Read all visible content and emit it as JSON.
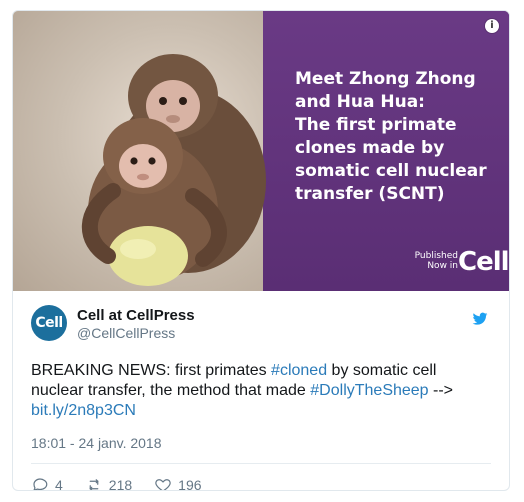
{
  "media": {
    "headline": "Meet Zhong Zhong\nand Hua Hua:\nThe first primate\nclones made by\nsomatic cell nuclear\ntransfer (SCNT)",
    "published": "Published\nNow in",
    "wordmark": "Cell",
    "info_icon": "info-icon"
  },
  "author": {
    "avatar_text": "Cell",
    "name": "Cell at CellPress",
    "handle": "@CellCellPress",
    "bird_icon": "twitter-bird-icon"
  },
  "tweet": {
    "text_1": "BREAKING NEWS: first primates ",
    "hashtag_1": "#cloned",
    "text_2": " by somatic cell nuclear transfer, the method that made ",
    "hashtag_2": "#DollyTheSheep",
    "text_3": " -->",
    "link": "bit.ly/2n8p3CN",
    "timestamp": "18:01 - 24 janv. 2018"
  },
  "actions": {
    "reply_count": "4",
    "retweet_count": "218",
    "like_count": "196"
  },
  "colors": {
    "link": "#2b7bb9",
    "purple": "#5a2e74",
    "muted": "#657786"
  }
}
